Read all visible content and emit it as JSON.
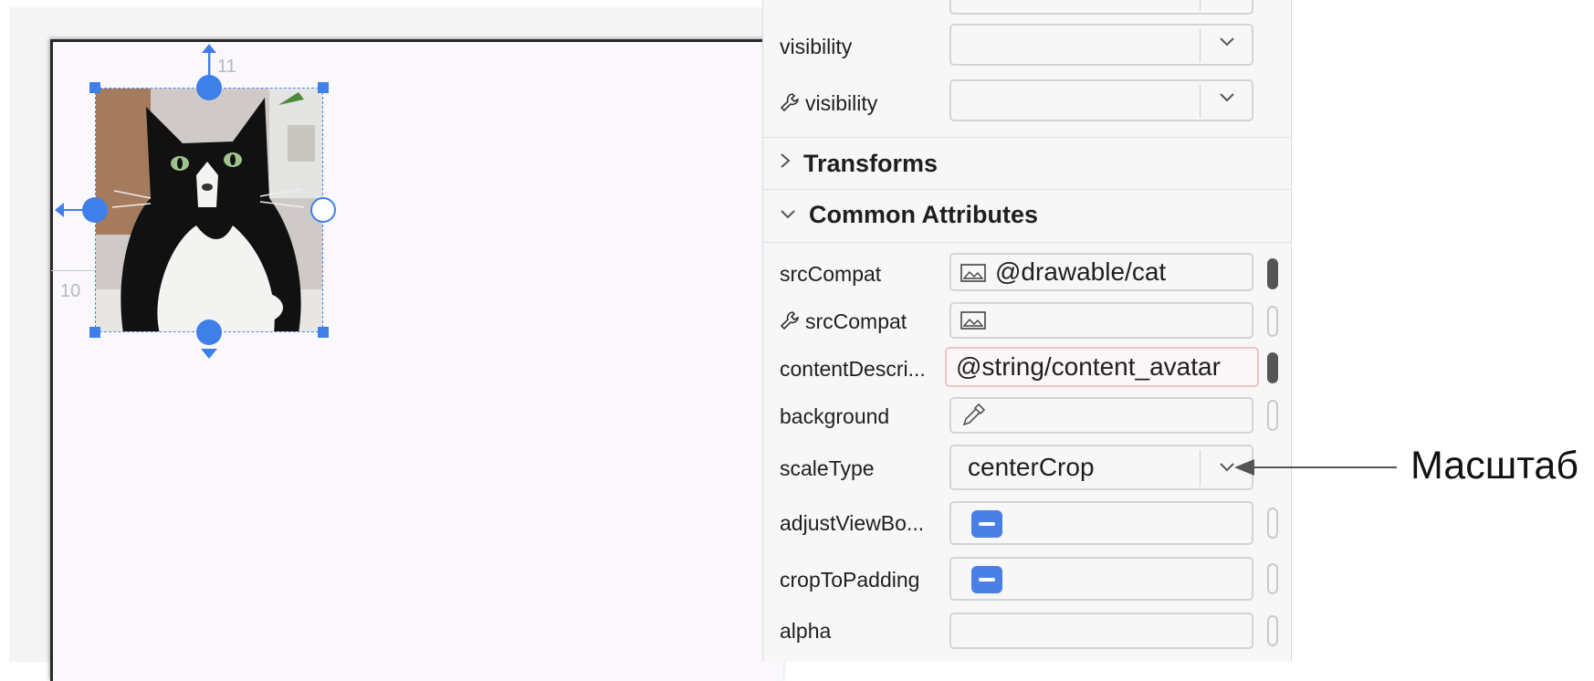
{
  "canvas": {
    "margin_top": "11",
    "margin_left": "10"
  },
  "attributes_panel": {
    "rows_top": [
      {
        "label": "visibility",
        "value": ""
      },
      {
        "label": "visibility",
        "value": "",
        "tools_attribute": true
      }
    ],
    "sections": {
      "transforms": "Transforms",
      "common_attributes": "Common Attributes"
    },
    "common": {
      "srcCompat": {
        "label": "srcCompat",
        "value": "@drawable/cat"
      },
      "srcCompat_tools": {
        "label": "srcCompat",
        "value": ""
      },
      "contentDescription": {
        "label": "contentDescri...",
        "value": "@string/content_avatar"
      },
      "background": {
        "label": "background",
        "value": ""
      },
      "scaleType": {
        "label": "scaleType",
        "value": "centerCrop"
      },
      "adjustViewBounds": {
        "label": "adjustViewBo..."
      },
      "cropToPadding": {
        "label": "cropToPadding"
      },
      "alpha": {
        "label": "alpha",
        "value": ""
      }
    }
  },
  "annotation": {
    "label": "Масштаб"
  },
  "colors": {
    "selection_blue": "#3f7fe9",
    "error_border": "#f0c4c8"
  }
}
